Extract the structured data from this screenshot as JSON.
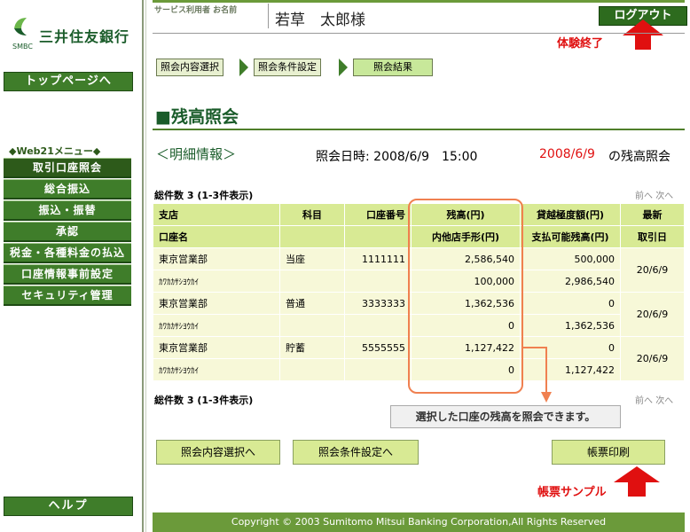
{
  "brand": {
    "name": "三井住友銀行",
    "sub": "SMBC"
  },
  "sidebar": {
    "top_button": "トップページへ",
    "web21_title": "◆Web21メニュー◆",
    "items": [
      {
        "label": "取引口座照会",
        "active": true
      },
      {
        "label": "総合振込"
      },
      {
        "label": "振込・振替"
      },
      {
        "label": "承認"
      },
      {
        "label": "税金・各種料金の払込"
      },
      {
        "label": "口座情報事前設定"
      },
      {
        "label": "セキュリティ管理"
      }
    ],
    "help_button": "ヘルプ"
  },
  "header": {
    "service_user_label": "サービス利用者 お名前",
    "username": "若草　太郎様",
    "logout_label": "ログアウト",
    "logout_note": "体験終了"
  },
  "steps": [
    "照会内容選択",
    "照会条件設定",
    "照会結果"
  ],
  "page_title": "■残高照会",
  "detail_label": "＜明細情報＞",
  "query_datetime": "照会日時: 2008/6/9　15:00",
  "query_date_red": "2008/6/9",
  "query_suffix": " の残高照会",
  "total_count": "総件数 3 (1-3件表示)",
  "pager": {
    "prev": "前へ",
    "next": "次へ"
  },
  "table": {
    "headers": {
      "branch": "支店",
      "account_name": "口座名",
      "subject": "科目",
      "account_no": "口座番号",
      "balance": "残高(円)",
      "check_other": "内他店手形(円)",
      "overdraft": "貸越極度額(円)",
      "available": "支払可能残高(円)",
      "latest": "最新",
      "txn_date": "取引日"
    },
    "rows": [
      {
        "branch": "東京営業部",
        "account_name": "ｶﾜｶｶｻｼﾖｳｶｲ",
        "subject": "当座",
        "account_no": "1111111",
        "balance": "2,586,540",
        "check_other": "100,000",
        "overdraft": "500,000",
        "available": "2,986,540",
        "date": "20/6/9"
      },
      {
        "branch": "東京営業部",
        "account_name": "ｶﾜｶｶｻｼﾖｳｶｲ",
        "subject": "普通",
        "account_no": "3333333",
        "balance": "1,362,536",
        "check_other": "0",
        "overdraft": "0",
        "available": "1,362,536",
        "date": "20/6/9"
      },
      {
        "branch": "東京営業部",
        "account_name": "ｶﾜｶｶｻｼﾖｳｶｲ",
        "subject": "貯蓄",
        "account_no": "5555555",
        "balance": "1,127,422",
        "check_other": "0",
        "overdraft": "0",
        "available": "1,127,422",
        "date": "20/6/9"
      }
    ]
  },
  "callout_text": "選択した口座の残高を照会できます。",
  "buttons": {
    "back_select": "照会内容選択へ",
    "back_condition": "照会条件設定へ",
    "print": "帳票印刷",
    "print_note": "帳票サンプル"
  },
  "footer": "Copyright © 2003 Sumitomo Mitsui Banking Corporation,All Rights Reserved",
  "colors": {
    "accent_green": "#3f7d2a",
    "note_red": "#e01010"
  }
}
